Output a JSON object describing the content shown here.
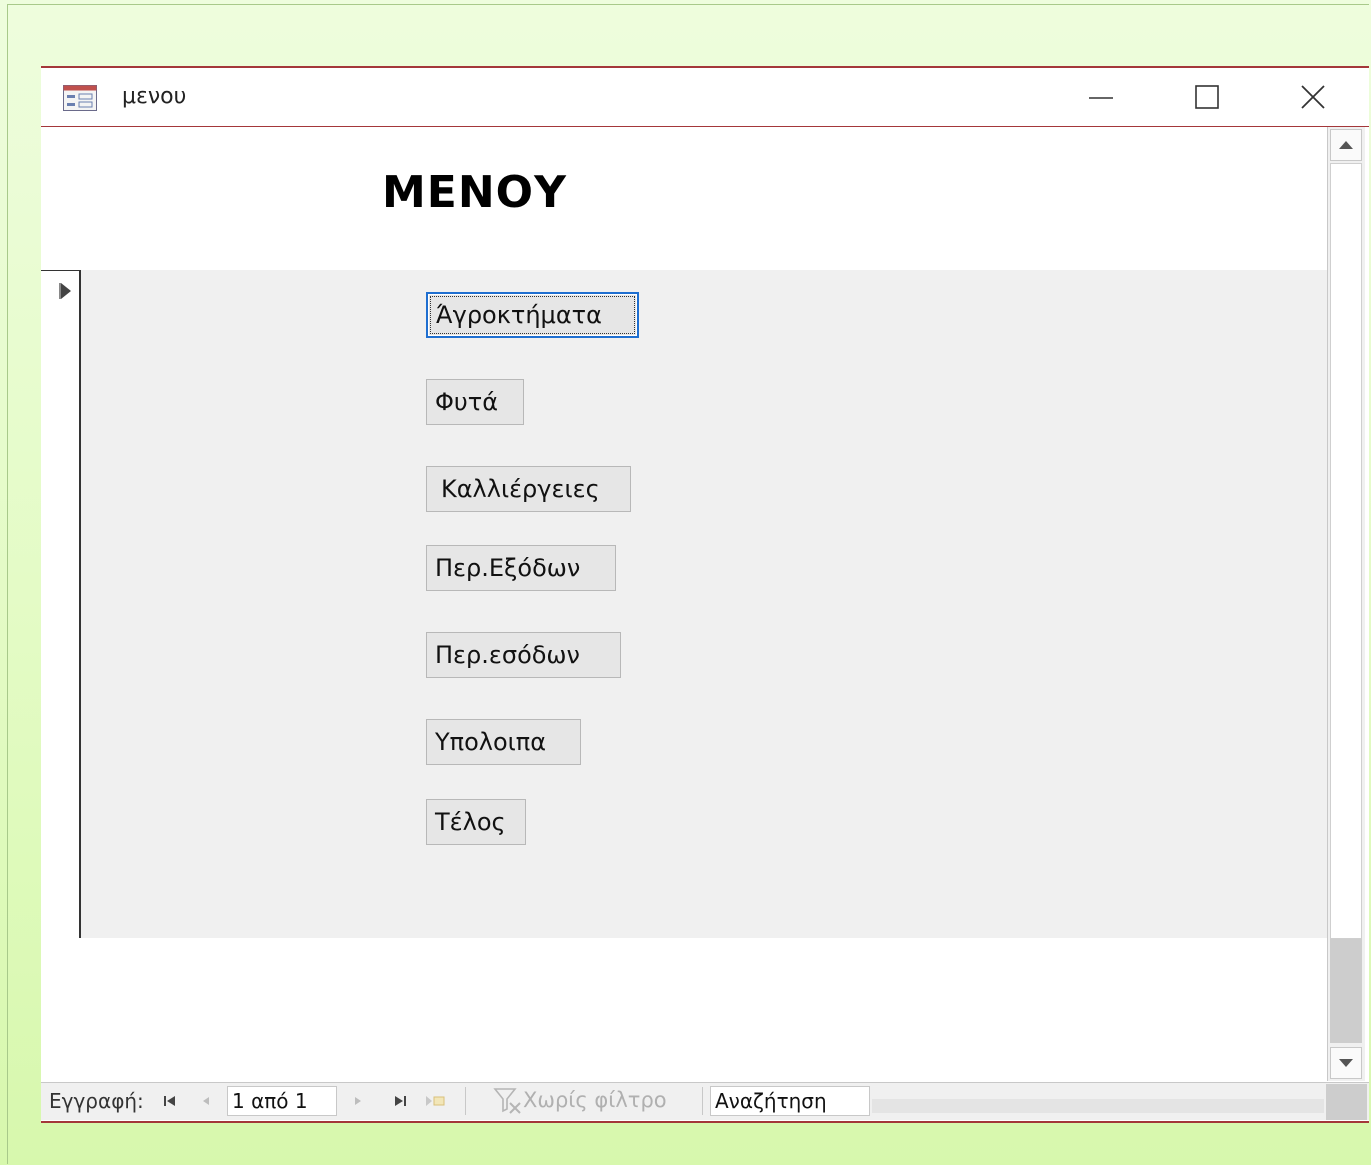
{
  "window": {
    "title": "μενου",
    "icon": "form-icon",
    "controls": [
      "minimize-icon",
      "maximize-icon",
      "close-icon"
    ]
  },
  "form": {
    "title": "ΜΕΝΟΥ",
    "buttons": [
      {
        "label": "Άγροκτήματα",
        "focused": true
      },
      {
        "label": "Φυτά"
      },
      {
        "label": "Καλλιέργειες"
      },
      {
        "label": "Περ.Εξόδων"
      },
      {
        "label": "Περ.εσόδων"
      },
      {
        "label": "Υπολοιπα"
      },
      {
        "label": "Τέλος"
      }
    ]
  },
  "navigation": {
    "record_label": "Εγγραφή:",
    "record_value": "1 από 1",
    "filter_label": "Χωρίς φίλτρο",
    "search_value": "Αναζήτηση"
  },
  "colors": {
    "window_border": "#a4373a",
    "detail_background": "#f0f0f0",
    "focus_border": "#1f6fd0",
    "page_background": "#e3fbc4"
  }
}
